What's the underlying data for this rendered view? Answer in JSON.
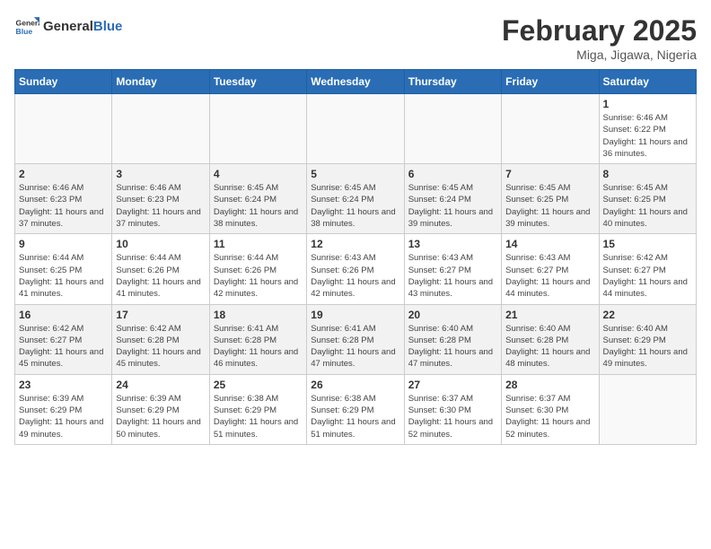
{
  "header": {
    "logo_general": "General",
    "logo_blue": "Blue",
    "month_year": "February 2025",
    "location": "Miga, Jigawa, Nigeria"
  },
  "weekdays": [
    "Sunday",
    "Monday",
    "Tuesday",
    "Wednesday",
    "Thursday",
    "Friday",
    "Saturday"
  ],
  "weeks": [
    [
      {
        "day": "",
        "info": ""
      },
      {
        "day": "",
        "info": ""
      },
      {
        "day": "",
        "info": ""
      },
      {
        "day": "",
        "info": ""
      },
      {
        "day": "",
        "info": ""
      },
      {
        "day": "",
        "info": ""
      },
      {
        "day": "1",
        "info": "Sunrise: 6:46 AM\nSunset: 6:22 PM\nDaylight: 11 hours and 36 minutes."
      }
    ],
    [
      {
        "day": "2",
        "info": "Sunrise: 6:46 AM\nSunset: 6:23 PM\nDaylight: 11 hours and 37 minutes."
      },
      {
        "day": "3",
        "info": "Sunrise: 6:46 AM\nSunset: 6:23 PM\nDaylight: 11 hours and 37 minutes."
      },
      {
        "day": "4",
        "info": "Sunrise: 6:45 AM\nSunset: 6:24 PM\nDaylight: 11 hours and 38 minutes."
      },
      {
        "day": "5",
        "info": "Sunrise: 6:45 AM\nSunset: 6:24 PM\nDaylight: 11 hours and 38 minutes."
      },
      {
        "day": "6",
        "info": "Sunrise: 6:45 AM\nSunset: 6:24 PM\nDaylight: 11 hours and 39 minutes."
      },
      {
        "day": "7",
        "info": "Sunrise: 6:45 AM\nSunset: 6:25 PM\nDaylight: 11 hours and 39 minutes."
      },
      {
        "day": "8",
        "info": "Sunrise: 6:45 AM\nSunset: 6:25 PM\nDaylight: 11 hours and 40 minutes."
      }
    ],
    [
      {
        "day": "9",
        "info": "Sunrise: 6:44 AM\nSunset: 6:25 PM\nDaylight: 11 hours and 41 minutes."
      },
      {
        "day": "10",
        "info": "Sunrise: 6:44 AM\nSunset: 6:26 PM\nDaylight: 11 hours and 41 minutes."
      },
      {
        "day": "11",
        "info": "Sunrise: 6:44 AM\nSunset: 6:26 PM\nDaylight: 11 hours and 42 minutes."
      },
      {
        "day": "12",
        "info": "Sunrise: 6:43 AM\nSunset: 6:26 PM\nDaylight: 11 hours and 42 minutes."
      },
      {
        "day": "13",
        "info": "Sunrise: 6:43 AM\nSunset: 6:27 PM\nDaylight: 11 hours and 43 minutes."
      },
      {
        "day": "14",
        "info": "Sunrise: 6:43 AM\nSunset: 6:27 PM\nDaylight: 11 hours and 44 minutes."
      },
      {
        "day": "15",
        "info": "Sunrise: 6:42 AM\nSunset: 6:27 PM\nDaylight: 11 hours and 44 minutes."
      }
    ],
    [
      {
        "day": "16",
        "info": "Sunrise: 6:42 AM\nSunset: 6:27 PM\nDaylight: 11 hours and 45 minutes."
      },
      {
        "day": "17",
        "info": "Sunrise: 6:42 AM\nSunset: 6:28 PM\nDaylight: 11 hours and 45 minutes."
      },
      {
        "day": "18",
        "info": "Sunrise: 6:41 AM\nSunset: 6:28 PM\nDaylight: 11 hours and 46 minutes."
      },
      {
        "day": "19",
        "info": "Sunrise: 6:41 AM\nSunset: 6:28 PM\nDaylight: 11 hours and 47 minutes."
      },
      {
        "day": "20",
        "info": "Sunrise: 6:40 AM\nSunset: 6:28 PM\nDaylight: 11 hours and 47 minutes."
      },
      {
        "day": "21",
        "info": "Sunrise: 6:40 AM\nSunset: 6:28 PM\nDaylight: 11 hours and 48 minutes."
      },
      {
        "day": "22",
        "info": "Sunrise: 6:40 AM\nSunset: 6:29 PM\nDaylight: 11 hours and 49 minutes."
      }
    ],
    [
      {
        "day": "23",
        "info": "Sunrise: 6:39 AM\nSunset: 6:29 PM\nDaylight: 11 hours and 49 minutes."
      },
      {
        "day": "24",
        "info": "Sunrise: 6:39 AM\nSunset: 6:29 PM\nDaylight: 11 hours and 50 minutes."
      },
      {
        "day": "25",
        "info": "Sunrise: 6:38 AM\nSunset: 6:29 PM\nDaylight: 11 hours and 51 minutes."
      },
      {
        "day": "26",
        "info": "Sunrise: 6:38 AM\nSunset: 6:29 PM\nDaylight: 11 hours and 51 minutes."
      },
      {
        "day": "27",
        "info": "Sunrise: 6:37 AM\nSunset: 6:30 PM\nDaylight: 11 hours and 52 minutes."
      },
      {
        "day": "28",
        "info": "Sunrise: 6:37 AM\nSunset: 6:30 PM\nDaylight: 11 hours and 52 minutes."
      },
      {
        "day": "",
        "info": ""
      }
    ]
  ]
}
